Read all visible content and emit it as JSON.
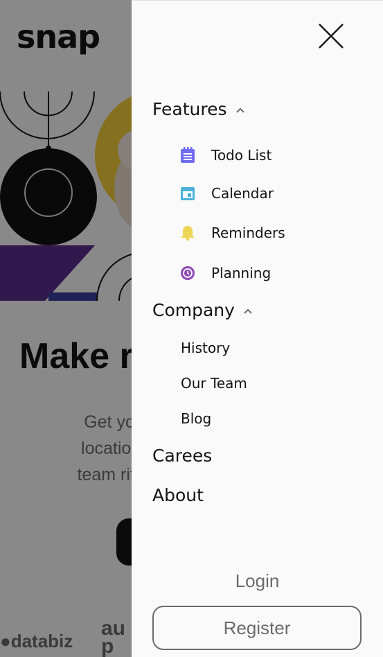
{
  "background": {
    "logo": "snap",
    "hero_title_visible": "Make r",
    "hero_subtitle_lines": [
      "Get your tea",
      "location. Stre",
      "team rituals, a"
    ],
    "clients": {
      "databiz": "databiz",
      "audio_1": "au",
      "audio_2": "p"
    }
  },
  "menu": {
    "features": {
      "label": "Features",
      "items": [
        {
          "label": "Todo List",
          "icon": "todo-list-icon",
          "color": "#726cee"
        },
        {
          "label": "Calendar",
          "icon": "calendar-icon",
          "color": "#4bb1da"
        },
        {
          "label": "Reminders",
          "icon": "bell-icon",
          "color": "#edd556"
        },
        {
          "label": "Planning",
          "icon": "clock-icon",
          "color": "#8e4cb6"
        }
      ]
    },
    "company": {
      "label": "Company",
      "items": [
        {
          "label": "History"
        },
        {
          "label": "Our Team"
        },
        {
          "label": "Blog"
        }
      ]
    },
    "careers": "Carees",
    "about": "About",
    "login": "Login",
    "register": "Register"
  },
  "colors": {
    "text": "#141414",
    "muted": "#6b6b6b",
    "drawer_bg": "#fafafa"
  }
}
